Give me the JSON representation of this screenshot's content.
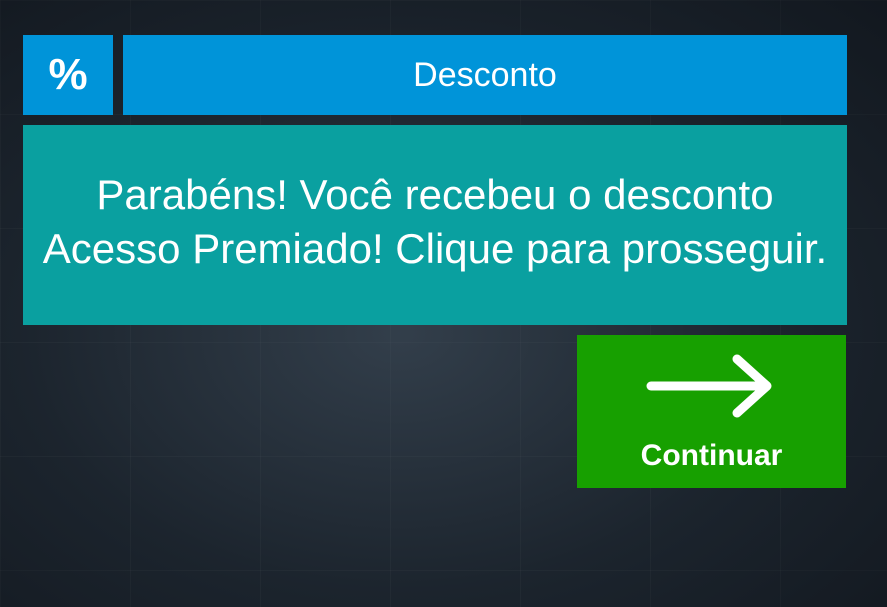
{
  "header": {
    "icon": "percent-icon",
    "icon_glyph": "%",
    "title": "Desconto"
  },
  "message": {
    "text": "Parabéns! Você recebeu o desconto Acesso Premiado! Clique para prosseguir."
  },
  "continue_button": {
    "icon": "arrow-right-icon",
    "label": "Continuar"
  },
  "colors": {
    "header_blue": "#0094d9",
    "message_teal": "#0aa0a0",
    "button_green": "#17a000",
    "background": "#1b232c",
    "text": "#ffffff"
  }
}
